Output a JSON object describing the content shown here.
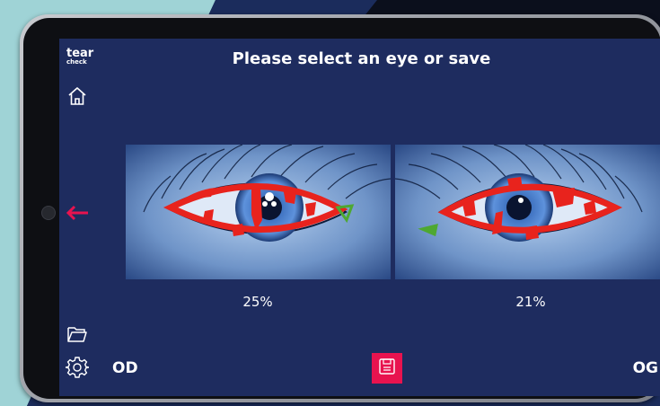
{
  "app": {
    "logo_line1": "tear",
    "logo_line2": "check",
    "title": "Please select an eye or save"
  },
  "sidebar": {
    "icons": [
      "home-icon",
      "back-arrow-icon",
      "folder-icon",
      "gear-icon"
    ]
  },
  "eyes": {
    "left": {
      "label": "OD",
      "percentage": "25%"
    },
    "right": {
      "label": "OG",
      "percentage": "21%"
    }
  },
  "toolbar": {
    "save_icon": "save-icon"
  },
  "colors": {
    "screen_bg": "#1e2c5f",
    "accent": "#e8134f",
    "overlay_red": "#e8231d",
    "overlay_green": "#4ea832"
  }
}
